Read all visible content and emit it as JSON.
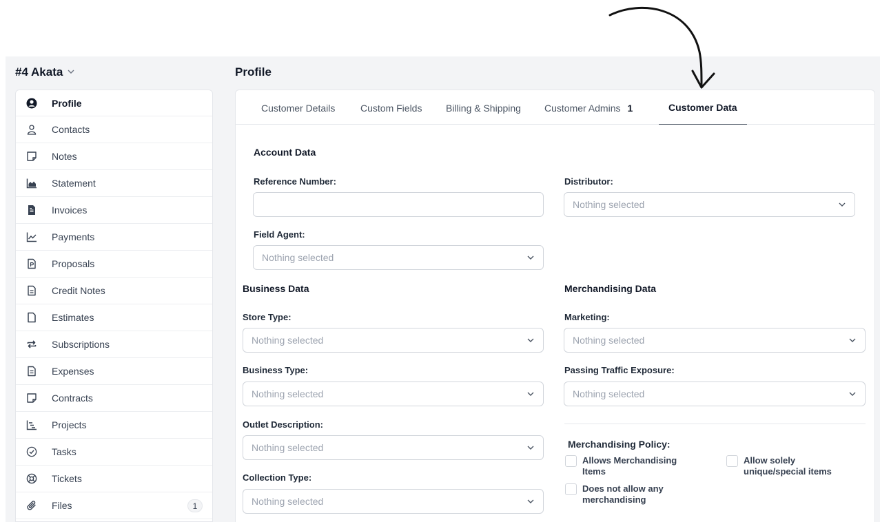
{
  "client": {
    "title": "#4 Akata"
  },
  "page": {
    "title": "Profile"
  },
  "sidebar": {
    "items": [
      {
        "label": "Profile",
        "icon": "user-circle-icon",
        "active": true
      },
      {
        "label": "Contacts",
        "icon": "user-icon"
      },
      {
        "label": "Notes",
        "icon": "note-icon"
      },
      {
        "label": "Statement",
        "icon": "area-chart-icon"
      },
      {
        "label": "Invoices",
        "icon": "file-text-icon"
      },
      {
        "label": "Payments",
        "icon": "line-chart-icon"
      },
      {
        "label": "Proposals",
        "icon": "proposal-file-icon"
      },
      {
        "label": "Credit Notes",
        "icon": "credit-note-icon"
      },
      {
        "label": "Estimates",
        "icon": "file-icon"
      },
      {
        "label": "Subscriptions",
        "icon": "repeat-icon"
      },
      {
        "label": "Expenses",
        "icon": "expense-file-icon"
      },
      {
        "label": "Contracts",
        "icon": "contract-icon"
      },
      {
        "label": "Projects",
        "icon": "gantt-icon"
      },
      {
        "label": "Tasks",
        "icon": "check-circle-icon"
      },
      {
        "label": "Tickets",
        "icon": "life-ring-icon"
      },
      {
        "label": "Files",
        "icon": "paperclip-icon",
        "badge": "1"
      }
    ]
  },
  "tabs": [
    {
      "label": "Customer Details"
    },
    {
      "label": "Custom Fields"
    },
    {
      "label": "Billing & Shipping"
    },
    {
      "label": "Customer Admins",
      "count": "1"
    },
    {
      "label": "Customer Data",
      "active": true
    }
  ],
  "form": {
    "account_title": "Account Data",
    "reference_label": "Reference Number:",
    "reference_value": "",
    "distributor_label": "Distributor:",
    "distributor_value": "Nothing selected",
    "field_agent_label": "Field Agent:",
    "field_agent_value": "Nothing selected",
    "business_title": "Business Data",
    "store_type_label": "Store Type:",
    "store_type_value": "Nothing selected",
    "business_type_label": "Business Type:",
    "business_type_value": "Nothing selected",
    "outlet_label": "Outlet Description:",
    "outlet_value": "Nothing selected",
    "collection_label": "Collection Type:",
    "collection_value": "Nothing selected",
    "merch_title": "Merchandising Data",
    "marketing_label": "Marketing:",
    "marketing_value": "Nothing selected",
    "traffic_label": "Passing Traffic Exposure:",
    "traffic_value": "Nothing selected",
    "policy_label": "Merchandising Policy:",
    "policy_options": [
      {
        "label_line1": "Allows Merchandising",
        "label_line2": "Items",
        "checked": false
      },
      {
        "label_line1": "Allow solely",
        "label_line2": "unique/special items",
        "checked": false
      },
      {
        "label_line1": "Does not allow any",
        "label_line2": "merchandising",
        "checked": false
      }
    ]
  },
  "colors": {
    "background": "#f3f4f6",
    "panel": "#ffffff",
    "border": "#e5e7eb",
    "text": "#1f2937",
    "muted": "#9ca3af",
    "active_tab_underline": "#4b5563"
  }
}
